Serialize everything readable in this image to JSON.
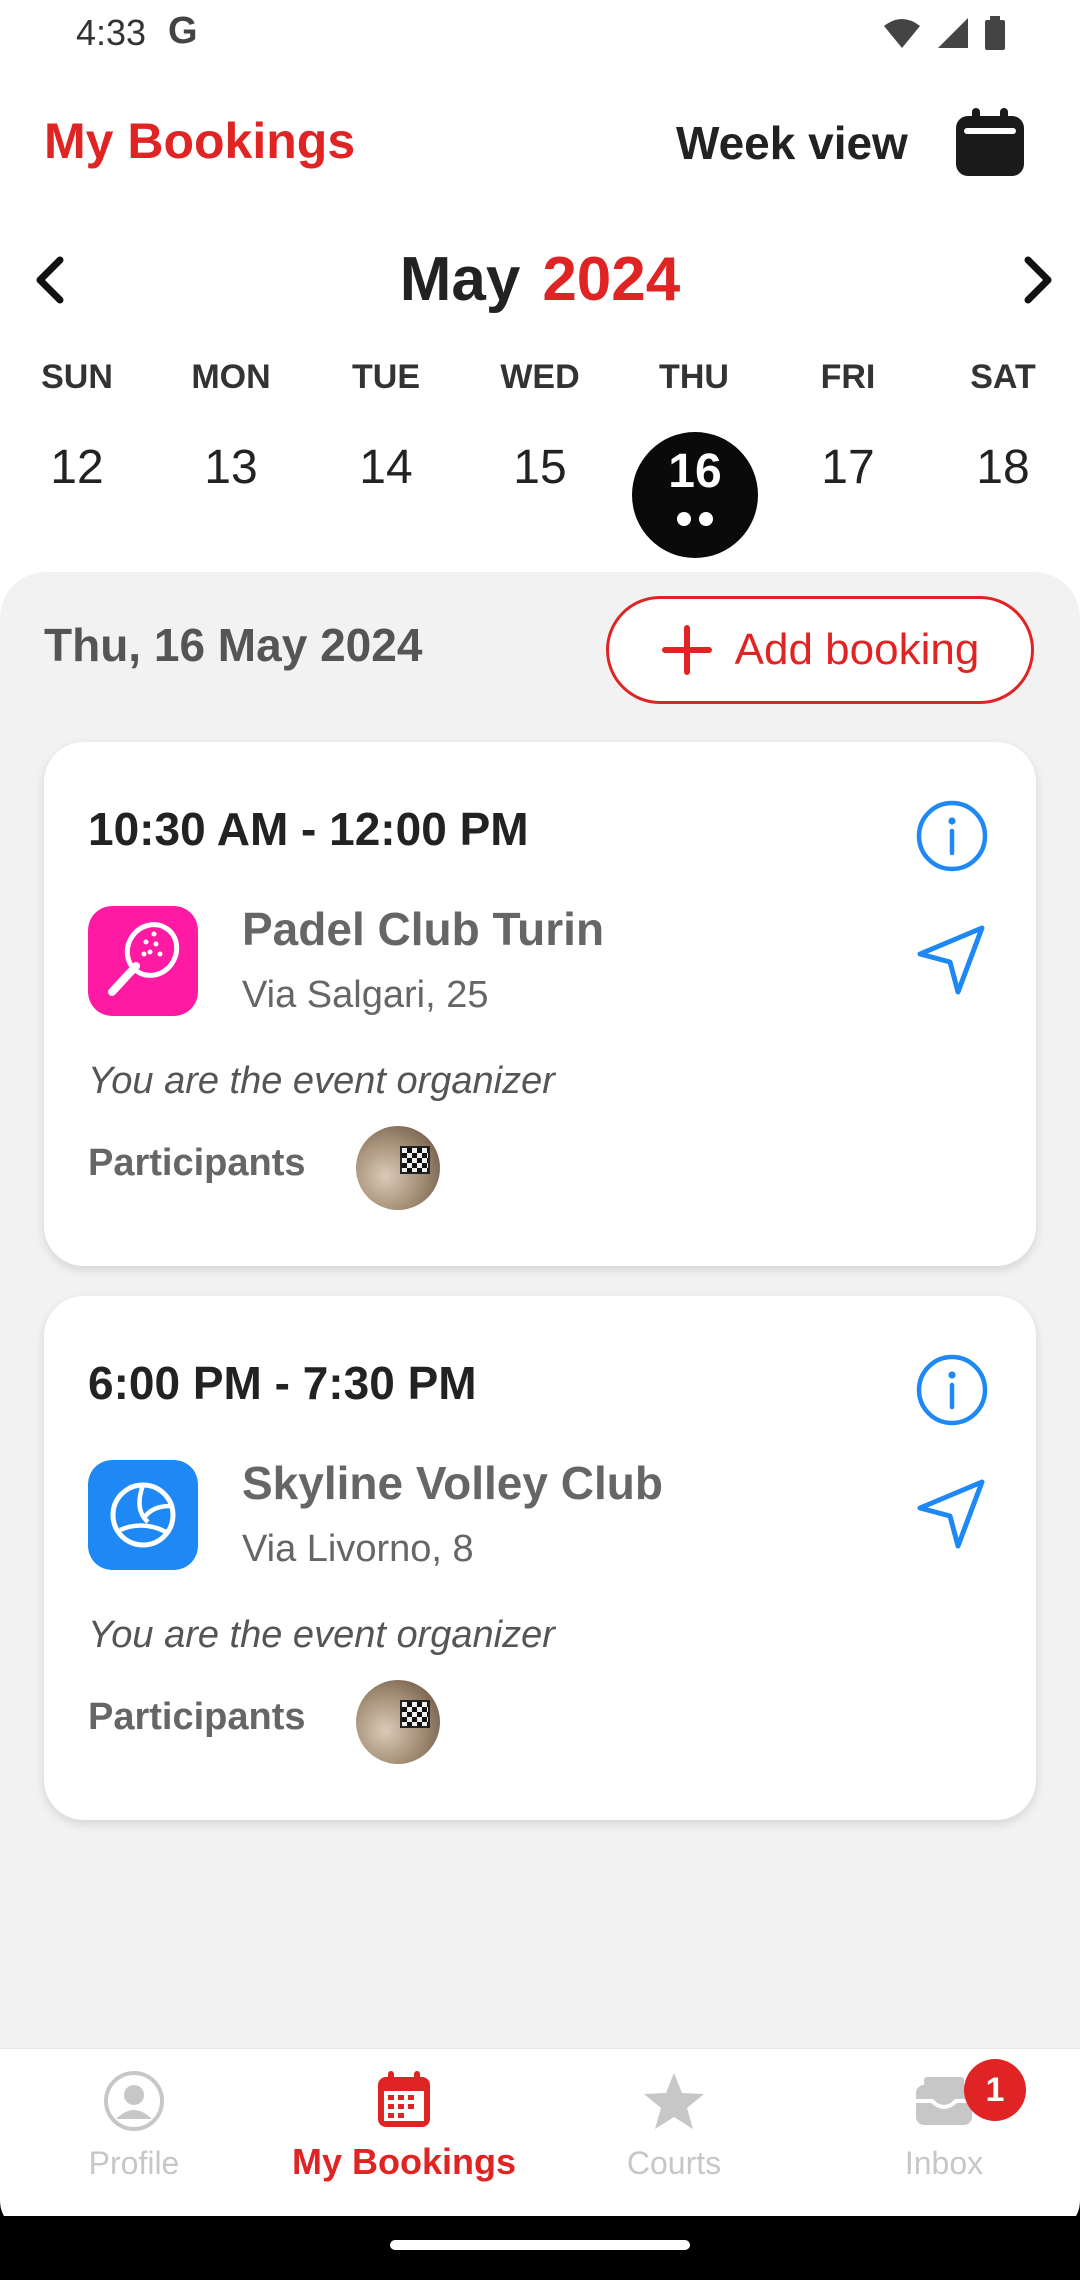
{
  "status": {
    "time": "4:33",
    "g_label": "G"
  },
  "header": {
    "title": "My Bookings",
    "week_view": "Week view"
  },
  "month_nav": {
    "month": "May",
    "year": "2024"
  },
  "weekdays": [
    "SUN",
    "MON",
    "TUE",
    "WED",
    "THU",
    "FRI",
    "SAT"
  ],
  "dates": [
    "12",
    "13",
    "14",
    "15",
    "16",
    "17",
    "18"
  ],
  "selected_date": "16",
  "day_header": {
    "label": "Thu, 16 May 2024",
    "add_button": "Add booking"
  },
  "bookings": [
    {
      "time": "10:30 AM - 12:00 PM",
      "venue": "Padel Club Turin",
      "address": "Via Salgari, 25",
      "organizer": "You are the event organizer",
      "participants_label": "Participants",
      "sport_icon": "padel-racket-icon",
      "logo_color": "#ff1aa3"
    },
    {
      "time": "6:00 PM - 7:30 PM",
      "venue": "Skyline Volley Club",
      "address": "Via Livorno, 8",
      "organizer": "You are the event organizer",
      "participants_label": "Participants",
      "sport_icon": "volleyball-icon",
      "logo_color": "#1e88f5"
    }
  ],
  "bottom_nav": {
    "items": [
      {
        "label": "Profile",
        "icon": "profile-icon"
      },
      {
        "label": "My Bookings",
        "icon": "calendar-icon"
      },
      {
        "label": "Courts",
        "icon": "star-icon"
      },
      {
        "label": "Inbox",
        "icon": "inbox-icon"
      }
    ],
    "inbox_badge": "1"
  },
  "colors": {
    "accent": "#e02424",
    "link": "#1e88f5",
    "panel": "#f2f2f2"
  }
}
